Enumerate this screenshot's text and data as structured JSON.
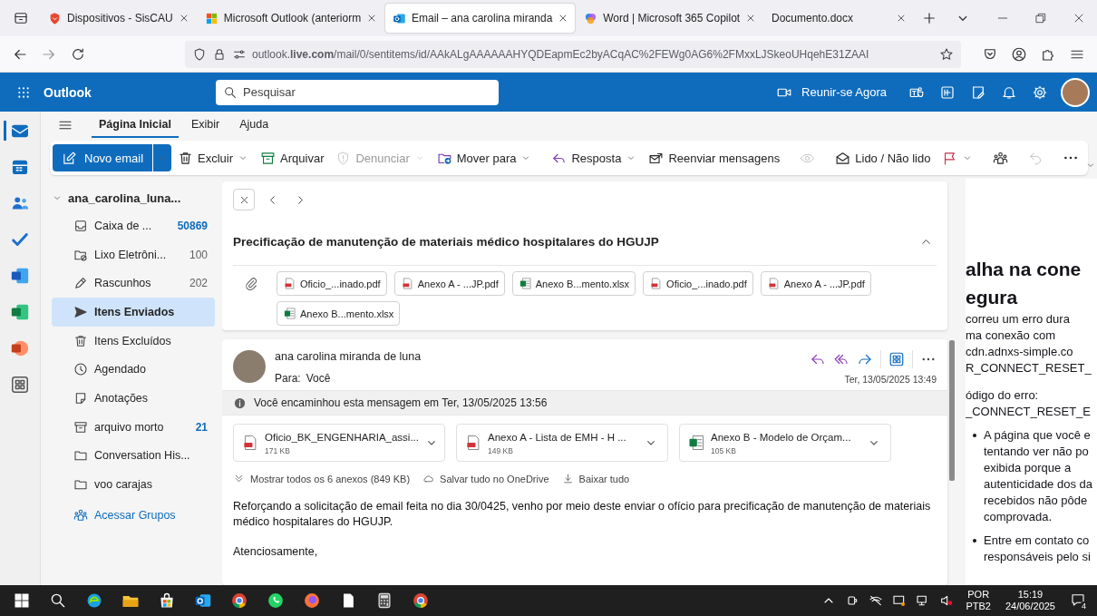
{
  "browser": {
    "tabs": [
      {
        "title": "Dispositivos - SisCAU",
        "selected": false
      },
      {
        "title": "Microsoft Outlook (anteriorm",
        "selected": false
      },
      {
        "title": "Email – ana carolina miranda",
        "selected": true
      },
      {
        "title": "Word | Microsoft 365 Copilot",
        "selected": false
      },
      {
        "title": "Documento.docx",
        "selected": false
      }
    ],
    "url": "outlook.**live.com**/mail/0/sentitems/id/AAkALgAAAAAAHYQDEapmEc2byACqAC%2FEWg0AG6%2FMxxLJSkeoUHqehE31ZAAI"
  },
  "header": {
    "app_name": "Outlook",
    "search_placeholder": "Pesquisar",
    "meet_now": "Reunir-se Agora"
  },
  "ribbon": {
    "tabs": [
      {
        "label": "Página Inicial",
        "selected": true
      },
      {
        "label": "Exibir",
        "selected": false
      },
      {
        "label": "Ajuda",
        "selected": false
      }
    ],
    "new_email": "Novo email",
    "actions": [
      {
        "label": "Excluir",
        "dropdown": true,
        "disabled": false
      },
      {
        "label": "Arquivar",
        "dropdown": false,
        "disabled": false
      },
      {
        "label": "Denunciar",
        "dropdown": true,
        "disabled": true
      },
      {
        "label": "Mover para",
        "dropdown": true,
        "disabled": false
      },
      {
        "label": "Resposta",
        "dropdown": true,
        "disabled": false
      },
      {
        "label": "Reenviar mensagens",
        "dropdown": false,
        "disabled": false
      },
      {
        "dropdown": false,
        "disabled": true
      },
      {
        "label": "Lido / Não lido",
        "dropdown": false,
        "disabled": false
      },
      {
        "dropdown": true,
        "disabled": false
      },
      {
        "dropdown": false,
        "disabled": false
      },
      {
        "dropdown": false,
        "disabled": true
      },
      {
        "dropdown": false,
        "disabled": false
      }
    ]
  },
  "folders": {
    "account": "ana_carolina_luna...",
    "expanded": true,
    "items": [
      {
        "name": "Caixa de ...",
        "count": "50869",
        "unread": true,
        "selected": false
      },
      {
        "name": "Lixo Eletrôni...",
        "count": "100",
        "unread": false,
        "selected": false
      },
      {
        "name": "Rascunhos",
        "count": "202",
        "unread": false,
        "selected": false
      },
      {
        "name": "Itens Enviados",
        "selected": true
      },
      {
        "name": "Itens Excluídos",
        "selected": false
      },
      {
        "name": "Agendado",
        "selected": false
      },
      {
        "name": "Anotações",
        "selected": false
      },
      {
        "name": "arquivo morto",
        "count": "21",
        "unread": true,
        "selected": false
      },
      {
        "name": "Conversation His...",
        "selected": false
      },
      {
        "name": "voo carajas",
        "selected": false
      }
    ],
    "groups_link": "Acessar Grupos"
  },
  "conversation": {
    "subject": "Precificação de manutenção de materiais médico hospitalares do HGUJP",
    "attachments": [
      {
        "name": "Oficio_...inado.pdf",
        "kind": "pdf"
      },
      {
        "name": "Anexo A - ...JP.pdf",
        "kind": "pdf"
      },
      {
        "name": "Anexo B...mento.xlsx",
        "kind": "xlsx"
      },
      {
        "name": "Oficio_...inado.pdf",
        "kind": "pdf"
      },
      {
        "name": "Anexo A - ...JP.pdf",
        "kind": "pdf"
      },
      {
        "name": "Anexo B...mento.xlsx",
        "kind": "xlsx"
      }
    ]
  },
  "message": {
    "sender": "ana carolina miranda de luna",
    "to_label": "Para:",
    "to": "Você",
    "date": "Ter, 13/05/2025 13:49",
    "notice": "Você encaminhou esta mensagem em Ter, 13/05/2025 13:56",
    "attachments": [
      {
        "name": "Oficio_BK_ENGENHARIA_assi...",
        "size": "171 KB",
        "kind": "pdf"
      },
      {
        "name": "Anexo A - Lista de EMH - H ...",
        "size": "149 KB",
        "kind": "pdf"
      },
      {
        "name": "Anexo B - Modelo de Orçam...",
        "size": "105 KB",
        "kind": "xlsx"
      }
    ],
    "show_all": "Mostrar todos os 6 anexos (849 KB)",
    "save_all": "Salvar tudo no OneDrive",
    "download_all": "Baixar tudo",
    "body": [
      "Reforçando a solicitação de email feita no dia 30/0425, venho por meio deste enviar o ofício para precificação de manutenção de materiais médico hospitalares do HGUJP.",
      "Atenciosamente,"
    ]
  },
  "error_page": {
    "heading": [
      "alha na cone",
      "egura"
    ],
    "lines": [
      "correu um erro dura",
      "ma conexão com",
      "cdn.adnxs-simple.co",
      "R_CONNECT_RESET_"
    ],
    "code_label": "ódigo do erro:",
    "code": "_CONNECT_RESET_E",
    "bullets": [
      [
        "A página que você e",
        "tentando ver não po",
        "exibida porque a",
        "autenticidade dos da",
        "recebidos não pôde",
        "comprovada."
      ],
      [
        "Entre em contato co",
        "responsáveis pelo si"
      ]
    ]
  },
  "taskbar": {
    "lang": "POR",
    "layout": "PTB2",
    "time": "15:19",
    "date": "24/06/2025",
    "notifications": "4"
  }
}
